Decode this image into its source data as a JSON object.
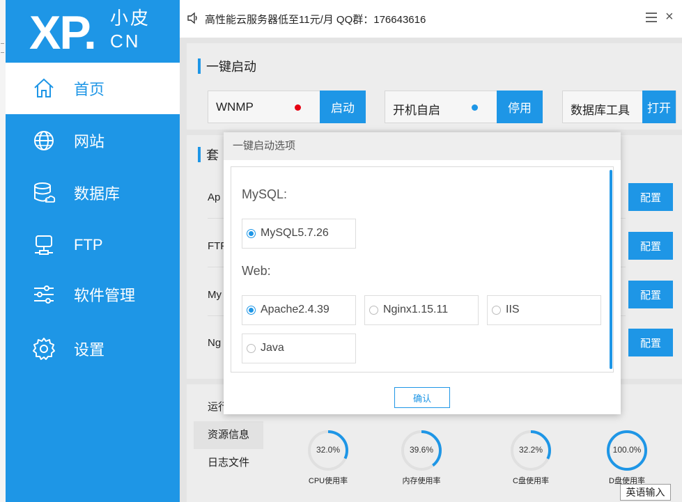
{
  "logo": {
    "main": "XP.",
    "sub_top": "小皮",
    "sub_bottom": "CN"
  },
  "nav": {
    "items": [
      {
        "label": "首页",
        "icon": "home-icon",
        "active": true
      },
      {
        "label": "网站",
        "icon": "globe-icon",
        "active": false
      },
      {
        "label": "数据库",
        "icon": "database-icon",
        "active": false
      },
      {
        "label": "FTP",
        "icon": "ftp-server-icon",
        "active": false
      },
      {
        "label": "软件管理",
        "icon": "sliders-icon",
        "active": false
      },
      {
        "label": "设置",
        "icon": "gear-icon",
        "active": false
      }
    ]
  },
  "topbar": {
    "announcement": "高性能云服务器低至11元/月  QQ群：176643616",
    "close_glyph": "×",
    "icons": [
      "speaker-icon",
      "menu-icon",
      "close-icon"
    ]
  },
  "quick_start": {
    "title": "一键启动",
    "items": [
      {
        "label": "WNMP",
        "button": "启动",
        "dot_color": "#e60012"
      },
      {
        "label": "开机自启",
        "button": "停用",
        "dot_color": "#1e96e6"
      },
      {
        "label": "数据库工具",
        "button": "打开"
      }
    ]
  },
  "suite": {
    "title_visible": "套",
    "rows": [
      {
        "label": "Ap",
        "button": "配置"
      },
      {
        "label": "FTP",
        "button": "配置"
      },
      {
        "label": "My",
        "button": "配置"
      },
      {
        "label": "Ng",
        "button": "配置"
      }
    ]
  },
  "bottom_tabs": [
    {
      "label": "运行",
      "active": false
    },
    {
      "label": "资源信息",
      "active": true
    },
    {
      "label": "日志文件",
      "active": false
    }
  ],
  "gauges": [
    {
      "value_text": "32.0%",
      "value": 32.0,
      "label": "CPU使用率"
    },
    {
      "value_text": "39.6%",
      "value": 39.6,
      "label": "内存使用率"
    },
    {
      "value_text": "32.2%",
      "value": 32.2,
      "label": "C盘使用率"
    },
    {
      "value_text": "100.0%",
      "value": 100.0,
      "label": "D盘使用率"
    }
  ],
  "dialog": {
    "title": "一键启动选项",
    "mysql_label": "MySQL:",
    "mysql_options": [
      {
        "label": "MySQL5.7.26",
        "checked": true
      }
    ],
    "web_label": "Web:",
    "web_options": [
      {
        "label": "Apache2.4.39",
        "checked": true
      },
      {
        "label": "Nginx1.15.11",
        "checked": false
      },
      {
        "label": "IIS",
        "checked": false
      },
      {
        "label": "Java",
        "checked": false
      }
    ],
    "confirm": "确认"
  },
  "ime": {
    "label": "英语输入"
  },
  "colors": {
    "accent": "#1e96e6",
    "stopped": "#e60012"
  }
}
